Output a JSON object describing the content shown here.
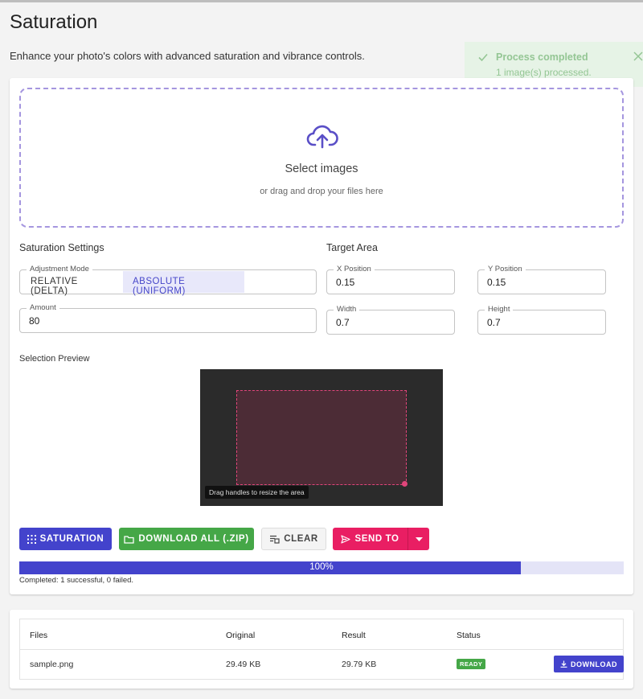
{
  "header": {
    "title": "Saturation",
    "subtitle": "Enhance your photo's colors with advanced saturation and vibrance controls."
  },
  "toast": {
    "title": "Process completed",
    "message": "1 image(s) processed."
  },
  "dropzone": {
    "title": "Select images",
    "hint": "or drag and drop your files here"
  },
  "settings": {
    "section_label": "Saturation Settings",
    "adjustment_mode": {
      "label": "Adjustment Mode",
      "options": [
        "RELATIVE (DELTA)",
        "ABSOLUTE (UNIFORM)"
      ],
      "selected": "ABSOLUTE (UNIFORM)"
    },
    "amount": {
      "label": "Amount",
      "value": "80"
    }
  },
  "target_area": {
    "section_label": "Target Area",
    "x": {
      "label": "X Position",
      "value": "0.15"
    },
    "y": {
      "label": "Y Position",
      "value": "0.15"
    },
    "width": {
      "label": "Width",
      "value": "0.7"
    },
    "height": {
      "label": "Height",
      "value": "0.7"
    }
  },
  "preview": {
    "label": "Selection Preview",
    "tooltip": "Drag handles to resize the area"
  },
  "actions": {
    "saturation": "SATURATION",
    "download_all": "DOWNLOAD ALL (.ZIP)",
    "clear": "CLEAR",
    "send_to": "SEND TO"
  },
  "progress": {
    "percent": 83,
    "label": "100%",
    "status": "Completed: 1 successful, 0 failed."
  },
  "files_table": {
    "headers": [
      "Files",
      "Original",
      "Result",
      "Status"
    ],
    "rows": [
      {
        "file": "sample.png",
        "original": "29.49 KB",
        "result": "29.79 KB",
        "status": "READY",
        "action": "DOWNLOAD"
      }
    ]
  },
  "colors": {
    "primary": "#4343cc",
    "success": "#45a747",
    "accent": "#e91e63",
    "dropzone_border": "#a596df"
  }
}
